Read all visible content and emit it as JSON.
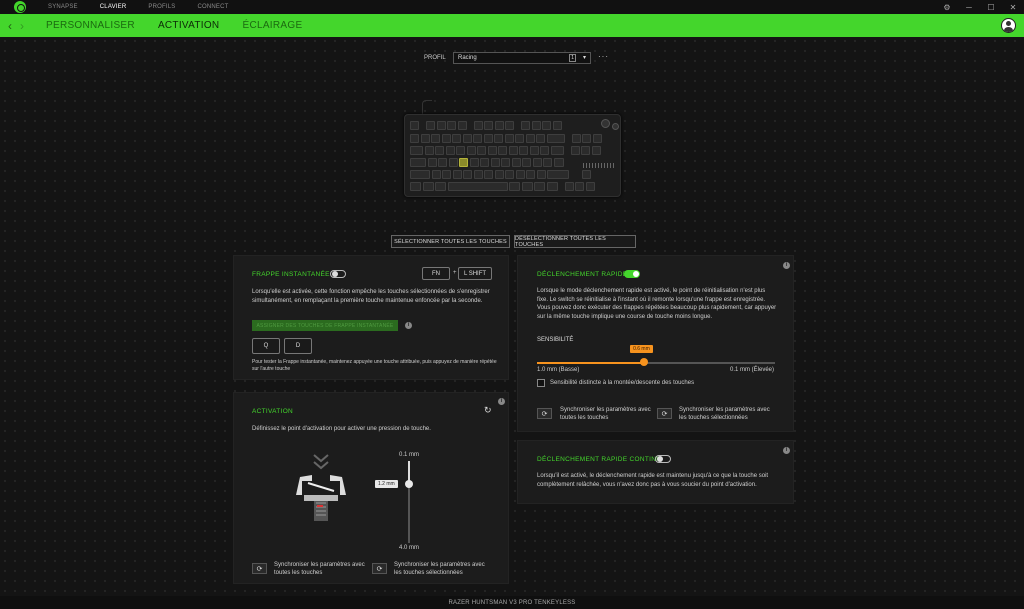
{
  "app": {
    "nav": [
      "SYNAPSE",
      "CLAVIER",
      "PROFILS",
      "CONNECT"
    ],
    "active_nav": "CLAVIER",
    "window_controls": [
      "⚙",
      "─",
      "☐",
      "✕"
    ]
  },
  "subnav": {
    "back": "‹",
    "forward": "›",
    "tabs": [
      "PERSONNALISER",
      "ACTIVATION",
      "ÉCLAIRAGE"
    ],
    "active_tab": "ACTIVATION"
  },
  "profile": {
    "label": "PROFIL",
    "value": "Racing",
    "count": "1",
    "chevron": "▾",
    "more": "···"
  },
  "buttons": {
    "select_all": "SÉLECTIONNER TOUTES LES TOUCHES",
    "deselect_all": "DÉSÉLECTIONNER TOUTES LES TOUCHES"
  },
  "snap_tap": {
    "title": "FRAPPE INSTANTANÉE",
    "enabled": false,
    "key_fn": "FN",
    "plus": "+",
    "key_shift": "L SHIFT",
    "description": "Lorsqu'elle est activée, cette fonction empêche les touches sélectionnées de s'enregistrer simultanément, en remplaçant la première touche maintenue enfoncée par la seconde.",
    "assign_button": "ASSIGNER DES TOUCHES DE FRAPPE INSTANTANÉE",
    "key_1": "Q",
    "key_2": "D",
    "hint": "Pour tester la Frappe instantanée, maintenez appuyée une touche attribuée, puis appuyez de manière répétée sur l'autre touche"
  },
  "activation": {
    "title": "ACTIVATION",
    "description": "Définissez le point d'activation pour activer une pression de touche.",
    "top_label": "0.1 mm",
    "bottom_label": "4.0 mm",
    "value_label": "1.2 mm",
    "value_mm": 1.2,
    "min_mm": 0.1,
    "max_mm": 4.0,
    "sync_all": "Synchroniser les paramètres avec toutes les touches",
    "sync_selected": "Synchroniser les paramètres avec les touches sélectionnées"
  },
  "rapid_trigger": {
    "title": "DÉCLENCHEMENT RAPIDE",
    "enabled": true,
    "description": "Lorsque le mode déclenchement rapide est activé, le point de réinitialisation n'est plus fixe. Le switch se réinitialise à l'instant où il remonte lorsqu'une frappe est enregistrée. Vous pouvez donc exécuter des frappes répétées beaucoup plus rapidement, car appuyer sur la même touche implique une course de touche moins longue.",
    "sensitivity_label": "SENSIBILITÉ",
    "value_label": "0.6 mm",
    "value_fraction": 0.45,
    "low_label": "1.0 mm (Basse)",
    "high_label": "0.1 mm (Élevée)",
    "separate_label": "Sensibilité distincte à la montée/descente des touches",
    "sync_all": "Synchroniser les paramètres avec toutes les touches",
    "sync_selected": "Synchroniser les paramètres avec les touches sélectionnées"
  },
  "continuous": {
    "title": "DÉCLENCHEMENT RAPIDE CONTINU",
    "enabled": false,
    "description": "Lorsqu'il est activé, le déclenchement rapide est maintenu jusqu'à ce que la touche soit complètement relâchée, vous n'avez donc pas à vous soucier du point d'activation."
  },
  "footer": {
    "device": "RAZER HUNTSMAN V3 PRO TENKEYLESS"
  },
  "colors": {
    "accent": "#44d62c",
    "slider": "#f7931e",
    "panel": "#1c1c1c"
  },
  "icons": {
    "info": "i",
    "sync": "⟳",
    "reset": "↻",
    "chevrons": "︾"
  }
}
